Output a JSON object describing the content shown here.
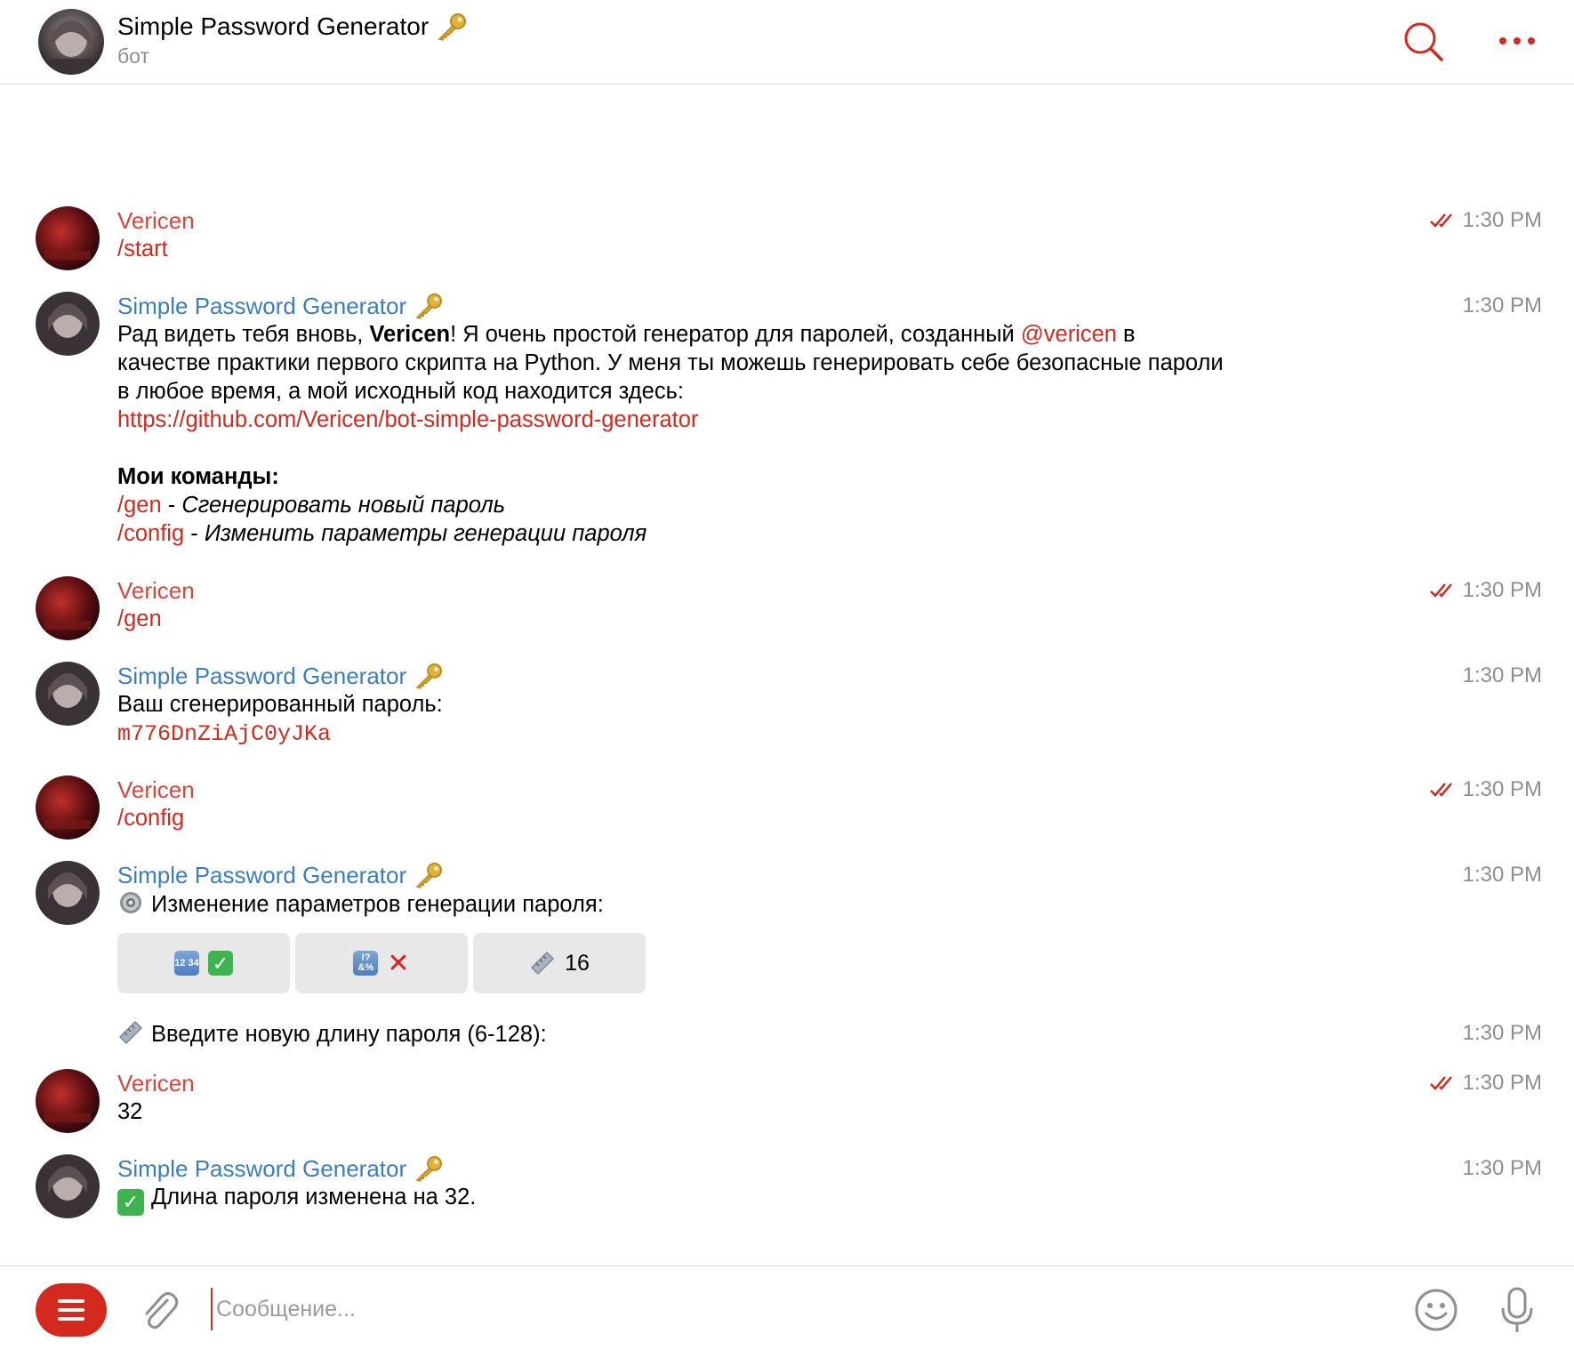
{
  "header": {
    "title": "Simple Password Generator",
    "title_emoji": "key-icon",
    "subtitle": "бот",
    "search_icon": "search-icon",
    "more_icon": "more-icon"
  },
  "colors": {
    "accent": "#d3291e",
    "user_name": "#d9453d",
    "bot_name": "#3b7dc4",
    "meta": "#8e8e93",
    "button_bg": "#e8e8e8"
  },
  "messages": [
    {
      "author": "Vericen",
      "time": "1:30 PM",
      "text": "/start",
      "read": true
    },
    {
      "author": "Simple Password Generator",
      "time": "1:30 PM",
      "greeting_prefix": "Рад видеть тебя вновь, ",
      "greeting_name": "Vericen",
      "greeting_mid": "! Я очень простой генератор для паролей, созданный ",
      "mention": "@vericen",
      "greeting_suffix": " в качестве практики первого скрипта на Python. У меня ты можешь генерировать себе безопасные пароли в любое время, а мой исходный код находится здесь:",
      "link": "https://github.com/Vericen/bot-simple-password-generator",
      "commands_title": "Мои команды:",
      "cmd1": "/gen",
      "cmd1_sep": " - ",
      "cmd1_desc": "Сгенерировать новый пароль",
      "cmd2": "/config",
      "cmd2_sep": " - ",
      "cmd2_desc": "Изменить параметры генерации пароля"
    },
    {
      "author": "Vericen",
      "time": "1:30 PM",
      "text": "/gen",
      "read": true
    },
    {
      "author": "Simple Password Generator",
      "time": "1:30 PM",
      "text": "Ваш сгенерированный пароль:",
      "password": "m776DnZiAjC0yJKa"
    },
    {
      "author": "Vericen",
      "time": "1:30 PM",
      "text": "/config",
      "read": true
    },
    {
      "author": "Simple Password Generator",
      "time": "1:30 PM",
      "text": "Изменение параметров генерации пароля:",
      "buttons": [
        {
          "icon": "numbers-icon",
          "icon_text": "12 34",
          "state_icon": "check-mark-icon",
          "label": ""
        },
        {
          "icon": "symbols-icon",
          "icon_text": "!? &%",
          "state_icon": "cross-mark-icon",
          "label": ""
        },
        {
          "icon": "ruler-icon",
          "label": "16"
        }
      ]
    },
    {
      "time": "1:30 PM",
      "text": "Введите новую длину пароля (6-128):"
    },
    {
      "author": "Vericen",
      "time": "1:30 PM",
      "text": "32",
      "read": true
    },
    {
      "author": "Simple Password Generator",
      "time": "1:30 PM",
      "text": "Длина пароля изменена на 32."
    }
  ],
  "input": {
    "placeholder": "Сообщение..."
  }
}
